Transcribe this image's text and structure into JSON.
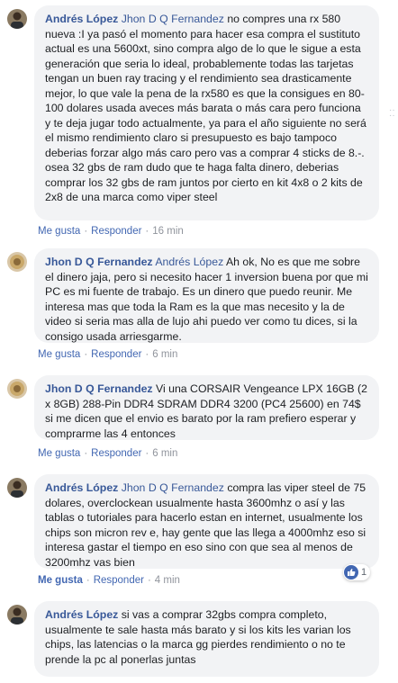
{
  "comments": [
    {
      "author": "Andrés López",
      "mention": "Jhon D Q Fernandez",
      "text": "no compres una rx 580 nueva :I ya pasó el momento para hacer esa compra el sustituto actual es una 5600xt, sino compra algo de lo que le sigue a esta generación que seria lo ideal, probablemente todas las tarjetas tengan un buen ray tracing y el rendimiento sea drasticamente mejor, lo que vale la pena de la rx580 es que la consigues en 80-100 dolares usada aveces más barata o más cara pero funciona y te deja jugar todo actualmente, ya para el año siguiente no será el mismo rendimiento claro si presupuesto es bajo tampoco deberias forzar algo más caro pero vas a comprar 4 sticks de 8.-. osea 32 gbs de ram dudo que te haga falta dinero, deberias comprar los 32 gbs de ram juntos por cierto en kit 4x8 o 2 kits de 2x8 de una marca como viper steel",
      "like_label": "Me gusta",
      "reply_label": "Responder",
      "time": "16 min"
    },
    {
      "author": "Jhon D Q Fernandez",
      "mention": "Andrés López",
      "text": "Ah ok, No es que me sobre el dinero jaja, pero si necesito hacer 1 inversion buena por que mi PC es mi fuente de trabajo. Es un dinero que puedo reunir. Me interesa mas que toda la Ram es la que mas necesito y la de video si seria mas alla de lujo ahi puedo ver como tu dices, si la consigo usada arriesgarme.",
      "like_label": "Me gusta",
      "reply_label": "Responder",
      "time": "6 min"
    },
    {
      "author": "Jhon D Q Fernandez",
      "mention": "",
      "text": "Vi una CORSAIR Vengeance LPX 16GB (2 x 8GB) 288-Pin DDR4 SDRAM DDR4 3200 (PC4 25600) en 74$ si me dicen que el envio es barato por la ram prefiero esperar y comprarme las 4 entonces",
      "like_label": "Me gusta",
      "reply_label": "Responder",
      "time": "6 min"
    },
    {
      "author": "Andrés López",
      "mention": "Jhon D Q Fernandez",
      "text": "compra las viper steel de 75 dolares, overclockean usualmente hasta 3600mhz o así y las tablas o tutoriales para hacerlo estan en internet, usualmente los chips son micron rev e, hay gente que las llega a 4000mhz eso si interesa gastar el tiempo en eso sino con que sea al menos de 3200mhz vas bien",
      "like_label": "Me gusta",
      "reply_label": "Responder",
      "time": "4 min",
      "reaction_count": "1"
    },
    {
      "author": "Andrés López",
      "mention": "",
      "text": "si vas a comprar 32gbs compra completo, usualmente te sale hasta más barato y si los kits les varian los chips, las latencias o la marca gg pierdes rendimiento o no te prende la pc al ponerlas juntas",
      "like_label": "",
      "reply_label": "",
      "time": ""
    }
  ],
  "colors": {
    "name_link": "#385898",
    "bubble_bg": "#f2f3f5",
    "like_active": "#4267b2",
    "meta_gray": "#90949c"
  }
}
